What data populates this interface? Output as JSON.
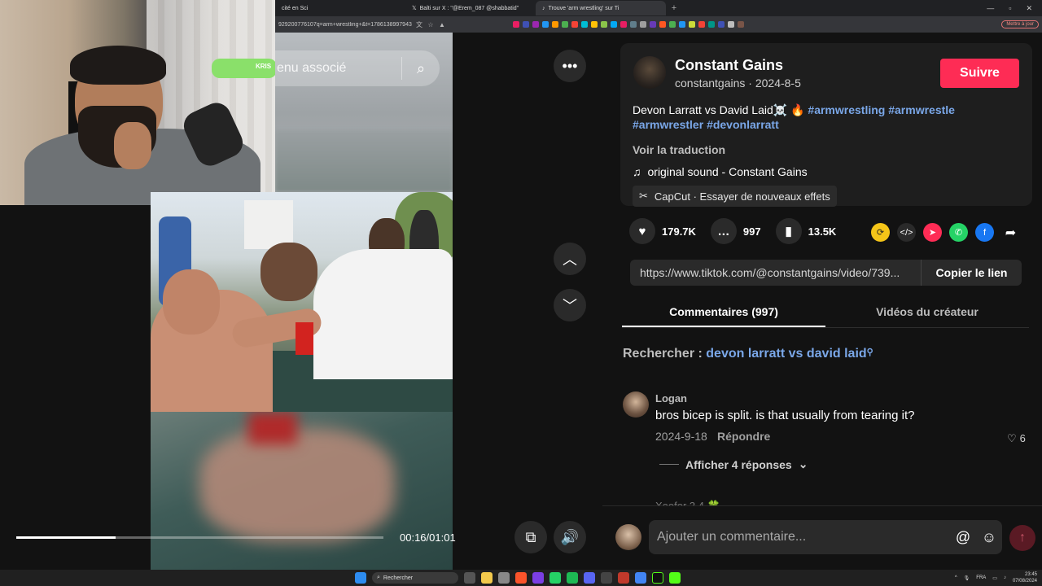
{
  "browser": {
    "tabs": [
      {
        "label": "cité en Sci"
      },
      {
        "label": "Balti sur X : \"@Erem_087 @shabbatid\""
      },
      {
        "label": "Trouve 'arm wrestling' sur Ti"
      }
    ],
    "url": "929200776107q=arm+wrestling+&t=1786138997943",
    "update_label": "Mettre à jour"
  },
  "webcam": {
    "boom_label": "KRIS"
  },
  "video": {
    "search_placeholder": "enu associé",
    "timecode": "00:16/01:01",
    "progress": 0.27
  },
  "post": {
    "author_name": "Constant Gains",
    "author_meta": "constantgains · 2024-8-5",
    "follow_label": "Suivre",
    "desc_text": "Devon Larratt vs David Laid☠️ 🔥 ",
    "hashtags": [
      "#armwrestling",
      "#armwrestle",
      "#armwrestler",
      "#devonlarratt"
    ],
    "translate_label": "Voir la traduction",
    "sound": "original sound - Constant Gains",
    "capcut": "CapCut · Essayer de nouveaux effets"
  },
  "stats": {
    "likes": "179.7K",
    "comments": "997",
    "saves": "13.5K"
  },
  "link": {
    "url": "https://www.tiktok.com/@constantgains/video/739...",
    "copy_label": "Copier le lien"
  },
  "tabs": {
    "comments": "Commentaires (997)",
    "creator": "Vidéos du créateur"
  },
  "related": {
    "prefix": "Rechercher : ",
    "query": "devon larratt vs david laid"
  },
  "comment": {
    "user": "Logan",
    "text": "bros bicep is split. is that usually from tearing it?",
    "date": "2024-9-18",
    "reply_label": "Répondre",
    "likes": "6",
    "more": "Afficher 4 réponses"
  },
  "comment2_partial": "Xoofor 3 4 🍀",
  "composer": {
    "placeholder": "Ajouter un commentaire..."
  },
  "taskbar": {
    "search": "Rechercher",
    "lang": "FRA",
    "time": "23:45",
    "date": "07/08/2024"
  },
  "colors": {
    "accent": "#fe2c55",
    "hashtag": "#7aa7e8"
  }
}
